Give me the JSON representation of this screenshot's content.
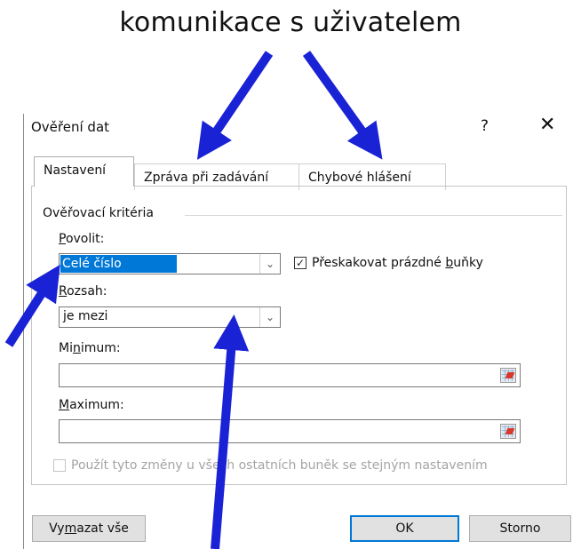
{
  "caption": "komunikace s uživatelem",
  "dialog": {
    "title": "Ověření dat",
    "help": "?",
    "close": "✕"
  },
  "tabs": [
    {
      "label": "Nastavení",
      "active": true
    },
    {
      "label": "Zpráva při zadávání",
      "active": false
    },
    {
      "label": "Chybové hlášení",
      "active": false
    }
  ],
  "settings": {
    "group_title": "Ověřovací kritéria",
    "allow": {
      "label_prefix": "",
      "label_hotkey": "P",
      "label_rest": "ovolit:",
      "value": "Celé číslo"
    },
    "ignore_blank": {
      "prefix": "Přeskakovat prázdné ",
      "hotkey": "b",
      "suffix": "uňky",
      "checked_glyph": "✓"
    },
    "data": {
      "label_prefix": "",
      "label_hotkey": "R",
      "label_rest": "ozsah:",
      "value": "je mezi"
    },
    "minimum": {
      "label_prefix": "Mi",
      "label_hotkey": "n",
      "label_rest": "imum:",
      "value": ""
    },
    "maximum": {
      "label_prefix": "",
      "label_hotkey": "M",
      "label_rest": "aximum:",
      "value": ""
    },
    "apply_all": {
      "label": "Použít tyto změny u všech ostatních buněk se stejným nastavením"
    }
  },
  "buttons": {
    "clear_prefix": "Vy",
    "clear_hotkey": "m",
    "clear_rest": "azat vše",
    "ok": "OK",
    "cancel": "Storno"
  },
  "colors": {
    "arrow": "#1a22d6",
    "selection": "#0078d7"
  },
  "icons": {
    "dropdown": "chevron-down-icon",
    "range_select": "range-select-icon",
    "checkbox": "checkmark-icon"
  }
}
